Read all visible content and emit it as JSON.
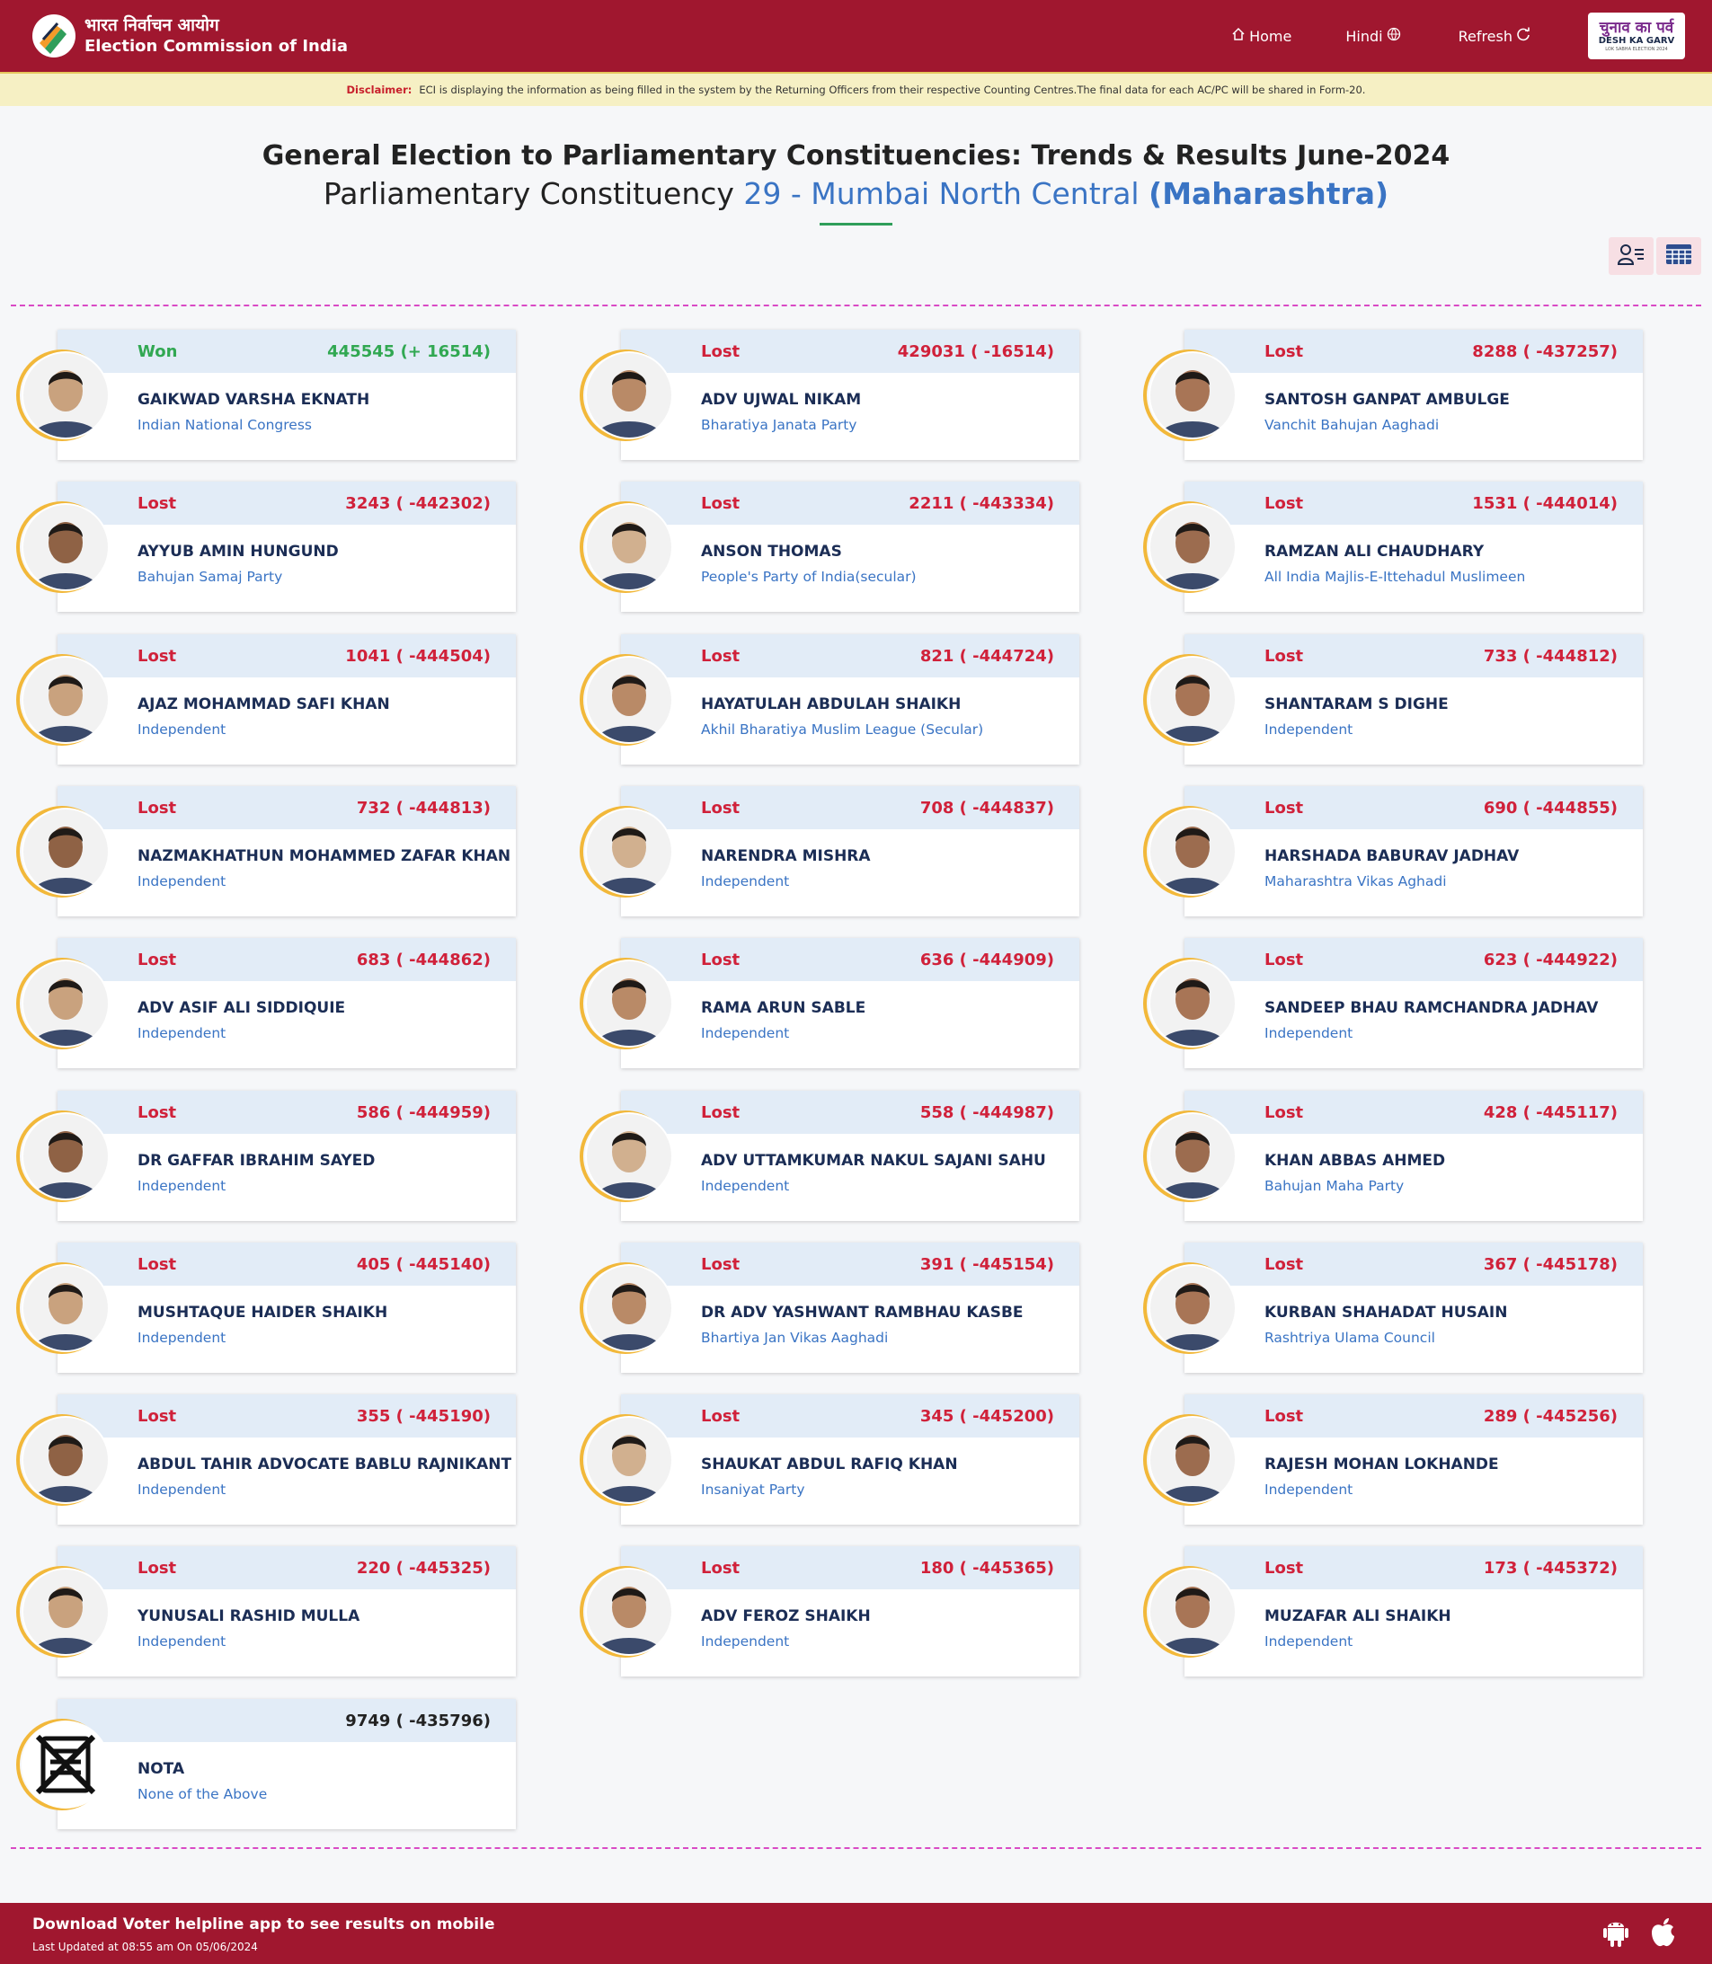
{
  "header": {
    "hindi_title": "भारत निर्वाचन आयोग",
    "english_title": "Election Commission of India",
    "nav": {
      "home": "Home",
      "hindi": "Hindi",
      "refresh": "Refresh"
    },
    "badge": {
      "line1": "चुनाव का पर्व",
      "line2": "DESH KA GARV",
      "line3": "LOK SABHA ELECTION 2024"
    }
  },
  "disclaimer": {
    "label": "Disclaimer:",
    "text": "ECI is displaying the information as being filled in the system by the Returning Officers from their respective Counting Centres.The final data for each AC/PC will be shared in Form-20."
  },
  "page": {
    "title": "General Election to Parliamentary Constituencies: Trends & Results June-2024",
    "subtitle_prefix": "Parliamentary Constituency",
    "constituency": "29 - Mumbai North Central",
    "state": "(Maharashtra)"
  },
  "colors": {
    "brand": "#a0172f",
    "won": "#31a852",
    "lost": "#d0213a",
    "accent": "#3a74c4",
    "ring": "#f2b83a"
  },
  "icons": {
    "list_view": "user-list-icon",
    "table_view": "table-grid-icon",
    "home": "home-icon",
    "globe": "globe-icon",
    "refresh": "refresh-icon",
    "android": "android-icon",
    "apple": "apple-icon"
  },
  "candidates": [
    {
      "status": "Won",
      "votes": "445545 (+ 16514)",
      "name": "GAIKWAD VARSHA EKNATH",
      "party": "Indian National Congress"
    },
    {
      "status": "Lost",
      "votes": "429031 ( -16514)",
      "name": "ADV UJWAL NIKAM",
      "party": "Bharatiya Janata Party"
    },
    {
      "status": "Lost",
      "votes": "8288 ( -437257)",
      "name": "SANTOSH GANPAT AMBULGE",
      "party": "Vanchit Bahujan Aaghadi"
    },
    {
      "status": "Lost",
      "votes": "3243 ( -442302)",
      "name": "AYYUB AMIN HUNGUND",
      "party": "Bahujan Samaj Party"
    },
    {
      "status": "Lost",
      "votes": "2211 ( -443334)",
      "name": "ANSON THOMAS",
      "party": "People's Party of India(secular)"
    },
    {
      "status": "Lost",
      "votes": "1531 ( -444014)",
      "name": "RAMZAN ALI CHAUDHARY",
      "party": "All India Majlis-E-Ittehadul Muslimeen"
    },
    {
      "status": "Lost",
      "votes": "1041 ( -444504)",
      "name": "AJAZ MOHAMMAD SAFI KHAN",
      "party": "Independent"
    },
    {
      "status": "Lost",
      "votes": "821 ( -444724)",
      "name": "HAYATULAH ABDULAH SHAIKH",
      "party": "Akhil Bharatiya Muslim League (Secular)"
    },
    {
      "status": "Lost",
      "votes": "733 ( -444812)",
      "name": "SHANTARAM S DIGHE",
      "party": "Independent"
    },
    {
      "status": "Lost",
      "votes": "732 ( -444813)",
      "name": "NAZMAKHATHUN MOHAMMED ZAFAR KHAN",
      "party": "Independent"
    },
    {
      "status": "Lost",
      "votes": "708 ( -444837)",
      "name": "NARENDRA MISHRA",
      "party": "Independent"
    },
    {
      "status": "Lost",
      "votes": "690 ( -444855)",
      "name": "HARSHADA BABURAV JADHAV",
      "party": "Maharashtra Vikas Aghadi"
    },
    {
      "status": "Lost",
      "votes": "683 ( -444862)",
      "name": "ADV ASIF ALI SIDDIQUIE",
      "party": "Independent"
    },
    {
      "status": "Lost",
      "votes": "636 ( -444909)",
      "name": "RAMA ARUN SABLE",
      "party": "Independent"
    },
    {
      "status": "Lost",
      "votes": "623 ( -444922)",
      "name": "SANDEEP BHAU RAMCHANDRA JADHAV",
      "party": "Independent"
    },
    {
      "status": "Lost",
      "votes": "586 ( -444959)",
      "name": "DR GAFFAR IBRAHIM SAYED",
      "party": "Independent"
    },
    {
      "status": "Lost",
      "votes": "558 ( -444987)",
      "name": "ADV UTTAMKUMAR NAKUL SAJANI SAHU",
      "party": "Independent"
    },
    {
      "status": "Lost",
      "votes": "428 ( -445117)",
      "name": "KHAN ABBAS AHMED",
      "party": "Bahujan Maha Party"
    },
    {
      "status": "Lost",
      "votes": "405 ( -445140)",
      "name": "MUSHTAQUE HAIDER SHAIKH",
      "party": "Independent"
    },
    {
      "status": "Lost",
      "votes": "391 ( -445154)",
      "name": "DR ADV YASHWANT RAMBHAU KASBE",
      "party": "Bhartiya Jan Vikas Aaghadi"
    },
    {
      "status": "Lost",
      "votes": "367 ( -445178)",
      "name": "KURBAN SHAHADAT HUSAIN",
      "party": "Rashtriya Ulama Council"
    },
    {
      "status": "Lost",
      "votes": "355 ( -445190)",
      "name": "ABDUL TAHIR ADVOCATE BABLU RAJNIKANT",
      "party": "Independent"
    },
    {
      "status": "Lost",
      "votes": "345 ( -445200)",
      "name": "SHAUKAT ABDUL RAFIQ KHAN",
      "party": "Insaniyat Party"
    },
    {
      "status": "Lost",
      "votes": "289 ( -445256)",
      "name": "RAJESH MOHAN LOKHANDE",
      "party": "Independent"
    },
    {
      "status": "Lost",
      "votes": "220 ( -445325)",
      "name": "YUNUSALI RASHID MULLA",
      "party": "Independent"
    },
    {
      "status": "Lost",
      "votes": "180 ( -445365)",
      "name": "ADV FEROZ SHAIKH",
      "party": "Independent"
    },
    {
      "status": "Lost",
      "votes": "173 ( -445372)",
      "name": "MUZAFAR ALI SHAIKH",
      "party": "Independent"
    },
    {
      "status": "",
      "votes": "9749 ( -435796)",
      "name": "NOTA",
      "party": "None of the Above"
    }
  ],
  "footer": {
    "app_text": "Download Voter helpline app to see results on mobile",
    "last_updated": "Last Updated at 08:55 am On 05/06/2024"
  }
}
